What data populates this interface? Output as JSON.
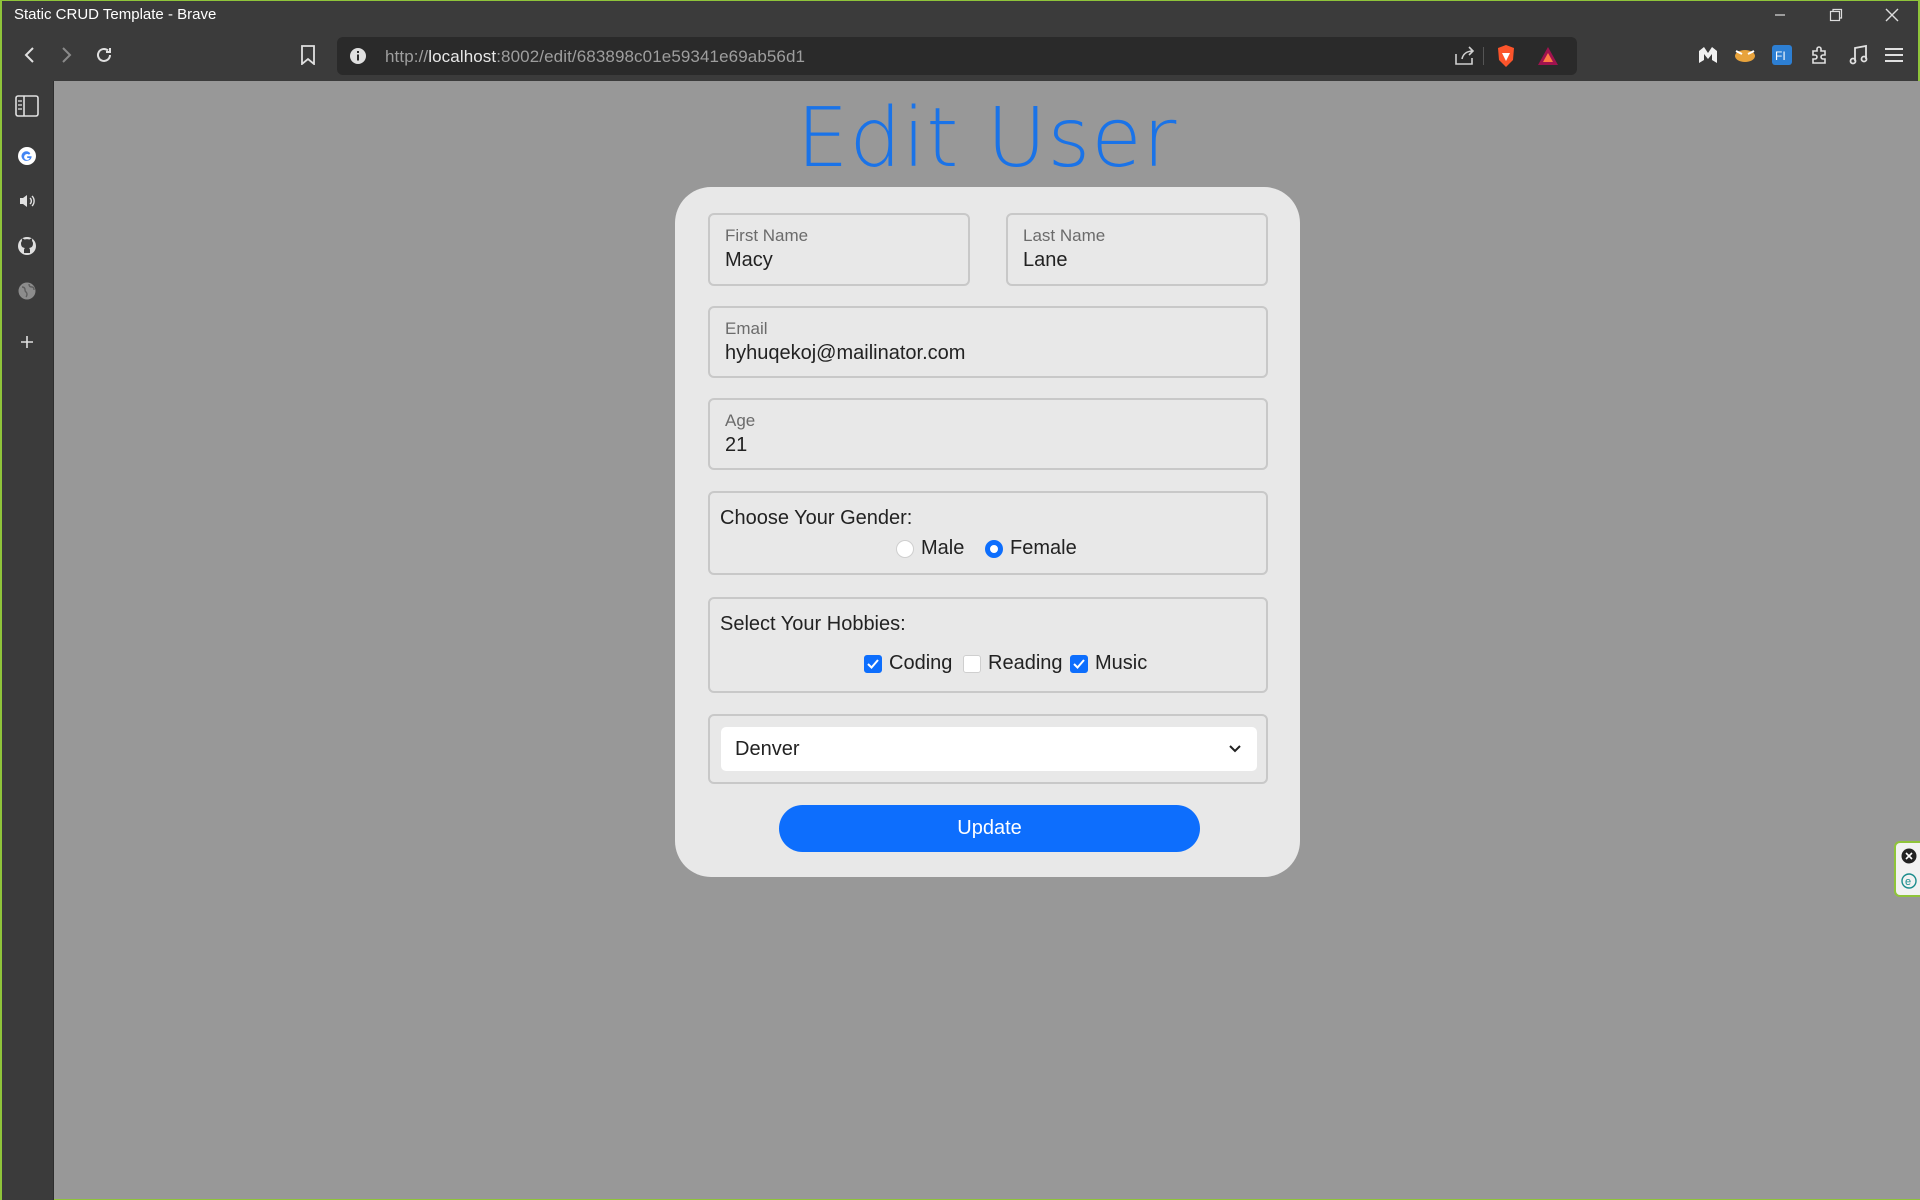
{
  "window": {
    "title": "Static CRUD Template - Brave"
  },
  "toolbar": {
    "url_scheme": "http://",
    "url_host": "localhost",
    "url_rest": ":8002/edit/683898c01e59341e69ab56d1"
  },
  "sidebar": {
    "items": [
      {
        "icon": "sidebar-panel-icon"
      },
      {
        "icon": "google-icon"
      },
      {
        "icon": "speaker-icon"
      },
      {
        "icon": "github-icon"
      },
      {
        "icon": "globe-icon"
      },
      {
        "icon": "add-icon"
      }
    ]
  },
  "page": {
    "title": "Edit User"
  },
  "form": {
    "first_name_label": "First Name",
    "first_name_value": "Macy",
    "last_name_label": "Last Name",
    "last_name_value": "Lane",
    "email_label": "Email",
    "email_value": "hyhuqekoj@mailinator.com",
    "age_label": "Age",
    "age_value": "21",
    "gender_title": "Choose Your Gender:",
    "gender_options": [
      {
        "label": "Male",
        "selected": false
      },
      {
        "label": "Female",
        "selected": true
      }
    ],
    "hobbies_title": "Select Your Hobbies:",
    "hobbies": [
      {
        "label": "Coding",
        "checked": true
      },
      {
        "label": "Reading",
        "checked": false
      },
      {
        "label": "Music",
        "checked": true
      }
    ],
    "city_selected": "Denver",
    "submit_label": "Update"
  },
  "colors": {
    "accent": "#0d6efd",
    "title": "#1a73e8",
    "background": "#989898",
    "card": "#e8e8e8"
  }
}
